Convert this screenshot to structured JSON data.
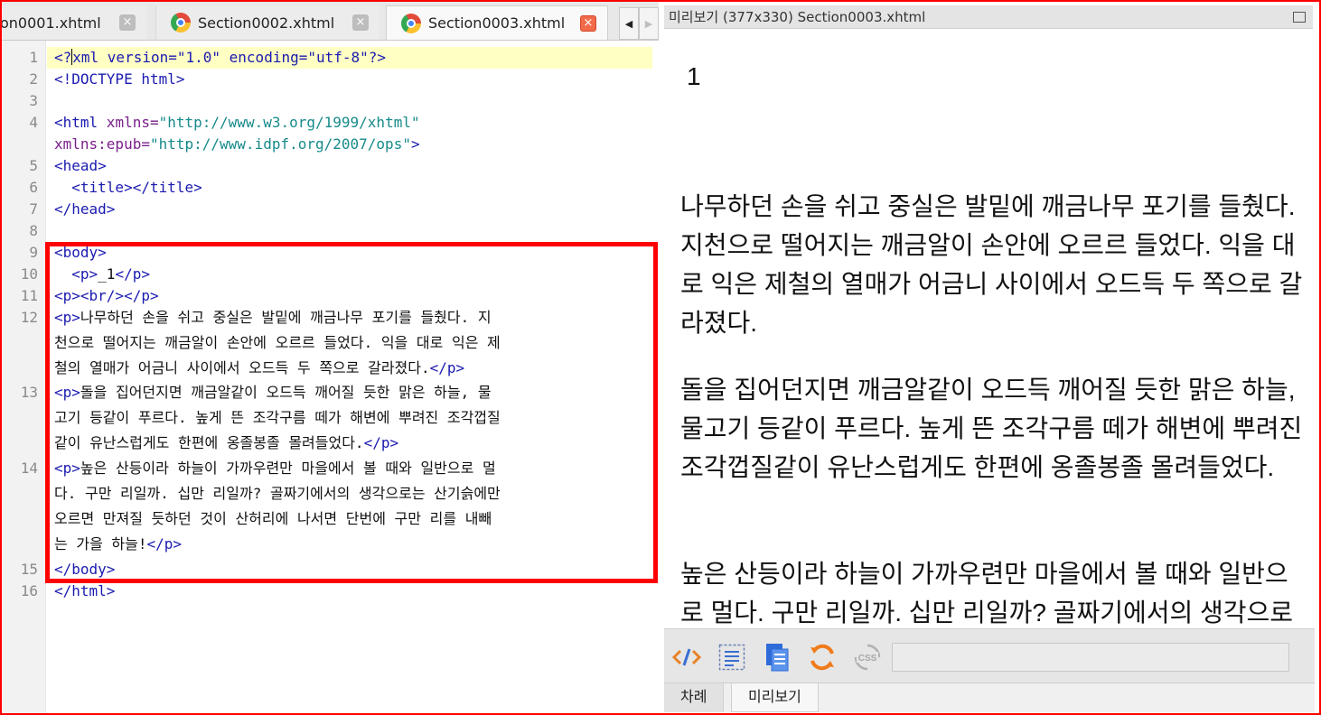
{
  "tabs": [
    {
      "label": "on0001.xhtml",
      "active": false
    },
    {
      "label": "Section0002.xhtml",
      "active": false
    },
    {
      "label": "Section0003.xhtml",
      "active": true
    }
  ],
  "tab_close_glyph": "×",
  "nav": {
    "prev": "◀",
    "next": "▶"
  },
  "editor": {
    "line_numbers": [
      "1",
      "2",
      "3",
      "4",
      "5",
      "6",
      "7",
      "8",
      "9",
      "10",
      "11",
      "12",
      "13",
      "14",
      "15",
      "16"
    ],
    "code": {
      "l1_a": "<?",
      "l1_b": "xml version=\"1.0\" encoding=\"utf-8\"?>",
      "l2": "<!DOCTYPE html>",
      "l4_tag": "<html",
      "l4_attr": " xmlns=",
      "l4_val": "\"http://www.w3.org/1999/xhtml\"",
      "l4b_attr": "xmlns:epub=",
      "l4b_val": "\"http://www.idpf.org/2007/ops\"",
      "l4b_end": ">",
      "l5": "<head>",
      "l6": "  <title></title>",
      "l7": "</head>",
      "l9": "<body>",
      "l10_a": "  <p>",
      "l10_b": "_1",
      "l10_c": "</p>",
      "l11": "<p><br/></p>",
      "l12_tag": "<p>",
      "l12_1": "나무하던 손을 쉬고 중실은 발밑에 깨금나무 포기를 들췄다. 지",
      "l12_2": "천으로 떨어지는 깨금알이 손안에 오르르 들었다. 익을 대로 익은 제",
      "l12_3": "철의 열매가 어금니 사이에서 오드득 두 쪽으로 갈라졌다.",
      "l12_end": "</p>",
      "l13_tag": "<p>",
      "l13_1": "돌을 집어던지면 깨금알같이 오드득 깨어질 듯한 맑은 하늘, 물",
      "l13_2": "고기 등같이 푸르다. 높게 뜬 조각구름 떼가 해변에 뿌려진 조각껍질",
      "l13_3": "같이 유난스럽게도 한편에 옹졸봉졸 몰려들었다.",
      "l13_end": "</p>",
      "l14_tag": "<p>",
      "l14_1": "높은 산등이라 하늘이 가까우련만 마을에서 볼 때와 일반으로 멀",
      "l14_2": "다. 구만 리일까. 십만 리일까? 골짜기에서의 생각으로는 산기슭에만",
      "l14_3": "오르면 만져질 듯하던 것이 산허리에 나서면 단번에 구만 리를 내빼",
      "l14_4": "는 가을 하늘!",
      "l14_end": "</p>",
      "l15": "</body>",
      "l16": "</html>"
    }
  },
  "preview": {
    "title": "미리보기 (377x330) Section0003.xhtml",
    "number": "1",
    "paragraphs": [
      "나무하던 손을 쉬고 중실은 발밑에 깨금나무 포기를 들췄다. 지천으로 떨어지는 깨금알이 손안에 오르르 들었다. 익을 대로 익은 제철의 열매가 어금니 사이에서 오드득 두 쪽으로 갈라졌다.",
      "돌을 집어던지면 깨금알같이 오드득 깨어질 듯한 맑은 하늘, 물고기 등같이 푸르다. 높게 뜬 조각구름 떼가 해변에 뿌려진 조각껍질같이 유난스럽게도 한편에 옹졸봉졸 몰려들었다.",
      "높은 산등이라 하늘이 가까우련만 마을에서 볼 때와 일반으로 멀다. 구만 리일까. 십만 리일까? 골짜기에서의 생각으로는 산기슭에만 오르면 만져질 듯하던 것이 산허리에 나서면 단번에 구만 리를 내빼는 가을 하늘!"
    ],
    "toolbar_icons": [
      "code-view-icon",
      "text-view-icon",
      "document-icon",
      "refresh-icon",
      "css-icon"
    ],
    "css_icon_text": "CSS"
  },
  "bottom_tabs": [
    "차례",
    "미리보기"
  ],
  "colors": {
    "highlight_box": "#ff0000",
    "current_line": "#ffffc4",
    "tag": "#1a1ab0",
    "value": "#178a8a"
  }
}
